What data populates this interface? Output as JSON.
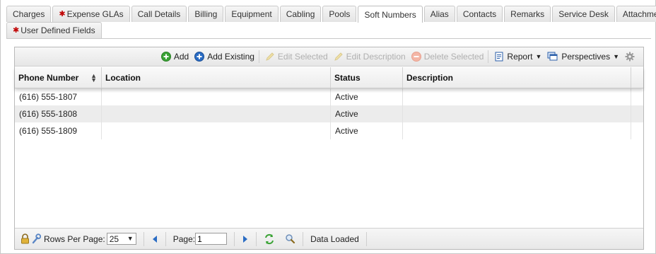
{
  "tabs": {
    "row1": [
      {
        "label": "Charges",
        "required": false,
        "active": false
      },
      {
        "label": "Expense GLAs",
        "required": true,
        "active": false
      },
      {
        "label": "Call Details",
        "required": false,
        "active": false
      },
      {
        "label": "Billing",
        "required": false,
        "active": false
      },
      {
        "label": "Equipment",
        "required": false,
        "active": false
      },
      {
        "label": "Cabling",
        "required": false,
        "active": false
      },
      {
        "label": "Pools",
        "required": false,
        "active": false
      },
      {
        "label": "Soft Numbers",
        "required": false,
        "active": true
      },
      {
        "label": "Alias",
        "required": false,
        "active": false
      },
      {
        "label": "Contacts",
        "required": false,
        "active": false
      },
      {
        "label": "Remarks",
        "required": false,
        "active": false
      },
      {
        "label": "Service Desk",
        "required": false,
        "active": false
      },
      {
        "label": "Attachments",
        "required": false,
        "active": false
      }
    ],
    "row2": [
      {
        "label": "User Defined Fields",
        "required": true,
        "active": false
      }
    ],
    "required_mark": "✱"
  },
  "toolbar": {
    "add": "Add",
    "add_existing": "Add Existing",
    "edit_selected": "Edit Selected",
    "edit_description": "Edit Description",
    "delete_selected": "Delete Selected",
    "report": "Report",
    "perspectives": "Perspectives"
  },
  "grid": {
    "headers": {
      "phone_number": "Phone Number",
      "location": "Location",
      "status": "Status",
      "description": "Description"
    },
    "rows": [
      {
        "phone_number": "(616) 555-1807",
        "location": "",
        "status": "Active",
        "description": ""
      },
      {
        "phone_number": "(616) 555-1808",
        "location": "",
        "status": "Active",
        "description": ""
      },
      {
        "phone_number": "(616) 555-1809",
        "location": "",
        "status": "Active",
        "description": ""
      }
    ]
  },
  "footer": {
    "rows_per_page_label": "Rows Per Page:",
    "rows_per_page_value": "25",
    "page_label": "Page:",
    "page_value": "1",
    "status_text": "Data Loaded"
  },
  "colors": {
    "accent_green": "#3aa335",
    "accent_blue": "#2a6cc4",
    "required_red": "#c00000"
  }
}
